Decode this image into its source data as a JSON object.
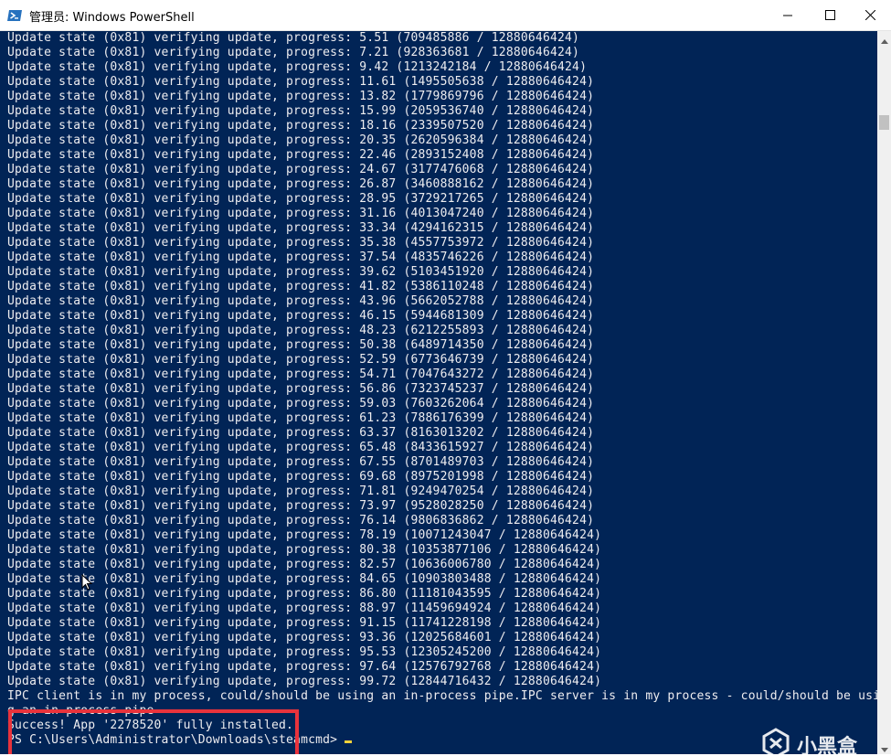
{
  "window": {
    "title": "管理员: Windows PowerShell",
    "icon": "powershell-icon",
    "controls": [
      "minimize-icon",
      "maximize-icon",
      "close-icon"
    ]
  },
  "console": {
    "background": "#012456",
    "text_color": "#eeedf0",
    "lines": [
      "Update state (0x81) verifying update, progress: 5.51 (709485886 / 12880646424)",
      "Update state (0x81) verifying update, progress: 7.21 (928363681 / 12880646424)",
      "Update state (0x81) verifying update, progress: 9.42 (1213242184 / 12880646424)",
      "Update state (0x81) verifying update, progress: 11.61 (1495505638 / 12880646424)",
      "Update state (0x81) verifying update, progress: 13.82 (1779869796 / 12880646424)",
      "Update state (0x81) verifying update, progress: 15.99 (2059536740 / 12880646424)",
      "Update state (0x81) verifying update, progress: 18.16 (2339507520 / 12880646424)",
      "Update state (0x81) verifying update, progress: 20.35 (2620596384 / 12880646424)",
      "Update state (0x81) verifying update, progress: 22.46 (2893152408 / 12880646424)",
      "Update state (0x81) verifying update, progress: 24.67 (3177476068 / 12880646424)",
      "Update state (0x81) verifying update, progress: 26.87 (3460888162 / 12880646424)",
      "Update state (0x81) verifying update, progress: 28.95 (3729217265 / 12880646424)",
      "Update state (0x81) verifying update, progress: 31.16 (4013047240 / 12880646424)",
      "Update state (0x81) verifying update, progress: 33.34 (4294162315 / 12880646424)",
      "Update state (0x81) verifying update, progress: 35.38 (4557753972 / 12880646424)",
      "Update state (0x81) verifying update, progress: 37.54 (4835746226 / 12880646424)",
      "Update state (0x81) verifying update, progress: 39.62 (5103451920 / 12880646424)",
      "Update state (0x81) verifying update, progress: 41.82 (5386110248 / 12880646424)",
      "Update state (0x81) verifying update, progress: 43.96 (5662052788 / 12880646424)",
      "Update state (0x81) verifying update, progress: 46.15 (5944681309 / 12880646424)",
      "Update state (0x81) verifying update, progress: 48.23 (6212255893 / 12880646424)",
      "Update state (0x81) verifying update, progress: 50.38 (6489714350 / 12880646424)",
      "Update state (0x81) verifying update, progress: 52.59 (6773646739 / 12880646424)",
      "Update state (0x81) verifying update, progress: 54.71 (7047643272 / 12880646424)",
      "Update state (0x81) verifying update, progress: 56.86 (7323745237 / 12880646424)",
      "Update state (0x81) verifying update, progress: 59.03 (7603262064 / 12880646424)",
      "Update state (0x81) verifying update, progress: 61.23 (7886176399 / 12880646424)",
      "Update state (0x81) verifying update, progress: 63.37 (8163013202 / 12880646424)",
      "Update state (0x81) verifying update, progress: 65.48 (8433615927 / 12880646424)",
      "Update state (0x81) verifying update, progress: 67.55 (8701489703 / 12880646424)",
      "Update state (0x81) verifying update, progress: 69.68 (8975201998 / 12880646424)",
      "Update state (0x81) verifying update, progress: 71.81 (9249470254 / 12880646424)",
      "Update state (0x81) verifying update, progress: 73.97 (9528028250 / 12880646424)",
      "Update state (0x81) verifying update, progress: 76.14 (9806836862 / 12880646424)",
      "Update state (0x81) verifying update, progress: 78.19 (10071243047 / 12880646424)",
      "Update state (0x81) verifying update, progress: 80.38 (10353877106 / 12880646424)",
      "Update state (0x81) verifying update, progress: 82.57 (10636006780 / 12880646424)",
      "Update state (0x81) verifying update, progress: 84.65 (10903803488 / 12880646424)",
      "Update state (0x81) verifying update, progress: 86.80 (11181043595 / 12880646424)",
      "Update state (0x81) verifying update, progress: 88.97 (11459694924 / 12880646424)",
      "Update state (0x81) verifying update, progress: 91.15 (11741228198 / 12880646424)",
      "Update state (0x81) verifying update, progress: 93.36 (12025684601 / 12880646424)",
      "Update state (0x81) verifying update, progress: 95.53 (12305245200 / 12880646424)",
      "Update state (0x81) verifying update, progress: 97.64 (12576792768 / 12880646424)",
      "Update state (0x81) verifying update, progress: 99.72 (12844716432 / 12880646424)",
      "IPC client is in my process, could/should be using an in-process pipe.IPC server is in my process - could/should be usin",
      "g an in process pipe",
      "Success! App '2278520' fully installed."
    ],
    "prompt": "PS C:\\Users\\Administrator\\Downloads\\steamcmd> ",
    "highlight_color": "#e8333c",
    "cursor_color": "#f5d23b"
  },
  "watermark": {
    "text": "小黑盒",
    "icon": "xiaoheihe-logo-icon"
  }
}
